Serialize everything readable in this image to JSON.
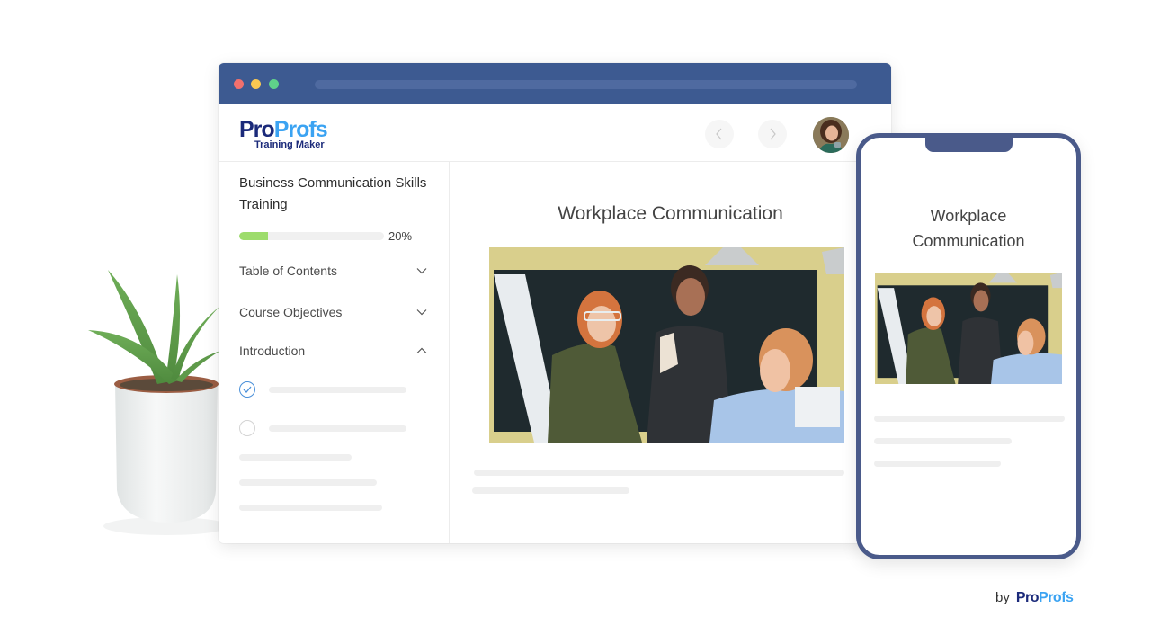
{
  "browser": {
    "window_controls": [
      "close",
      "minimize",
      "maximize"
    ],
    "colors": {
      "titlebar": "#3d5a91",
      "close": "#f2706d",
      "minimize": "#f9c852",
      "maximize": "#5fd18a"
    }
  },
  "header": {
    "logo": {
      "brand_part1": "Pro",
      "brand_part2": "Profs",
      "subtitle": "Training Maker"
    },
    "nav": {
      "prev_icon": "chevron-left-icon",
      "next_icon": "chevron-right-icon"
    },
    "avatar_icon": "user-avatar"
  },
  "sidebar": {
    "course_title": "Business Communication Skills Training",
    "progress": {
      "value": 20,
      "label": "20%",
      "color": "#9ddc6c"
    },
    "sections": [
      {
        "label": "Table of Contents",
        "expanded": false,
        "icon": "chevron-down-icon"
      },
      {
        "label": "Course Objectives",
        "expanded": false,
        "icon": "chevron-down-icon"
      },
      {
        "label": "Introduction",
        "expanded": true,
        "icon": "chevron-up-icon"
      }
    ],
    "lessons": [
      {
        "status": "completed",
        "icon": "check-circle-icon"
      },
      {
        "status": "incomplete",
        "icon": "empty-circle-icon"
      }
    ]
  },
  "content": {
    "title": "Workplace Communication",
    "image_alt": "Three colleagues talking around a computer in an office"
  },
  "phone": {
    "title": "Workplace Communication",
    "image_alt": "Three colleagues talking around a computer in an office",
    "frame_color": "#4a5a8a"
  },
  "footer": {
    "by": "by",
    "brand_part1": "Pro",
    "brand_part2": "Profs"
  }
}
